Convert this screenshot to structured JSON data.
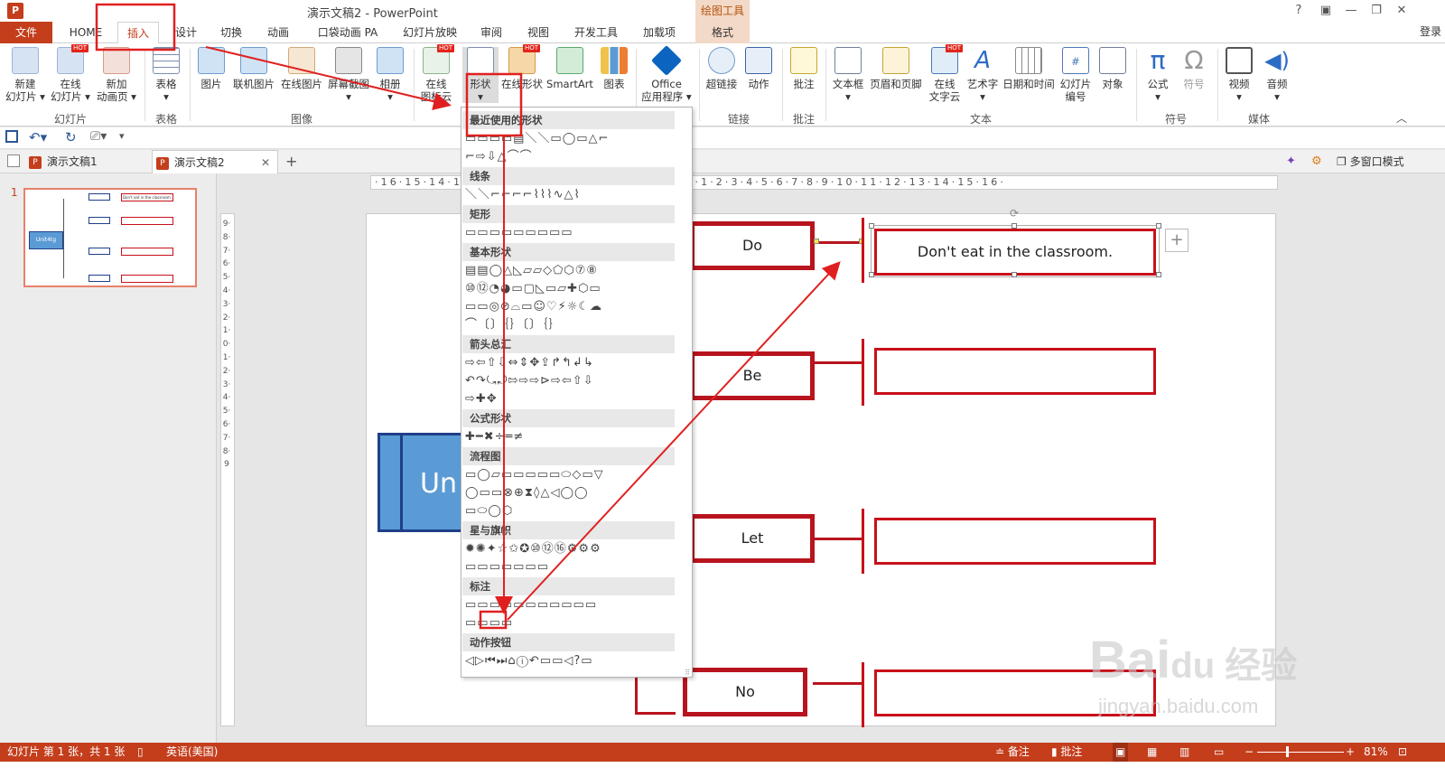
{
  "app": {
    "icon": "P",
    "title": "演示文稿2 - PowerPoint",
    "context_tab_title": "绘图工具",
    "login": "登录",
    "win_help": "?"
  },
  "tabs": [
    {
      "label": "文件"
    },
    {
      "label": "HOME"
    },
    {
      "label": "插入"
    },
    {
      "label": "设计"
    },
    {
      "label": "切换"
    },
    {
      "label": "动画"
    },
    {
      "label": "口袋动画 PA"
    },
    {
      "label": "幻灯片放映"
    },
    {
      "label": "审阅"
    },
    {
      "label": "视图"
    },
    {
      "label": "开发工具"
    },
    {
      "label": "加载项"
    },
    {
      "label": "格式"
    }
  ],
  "ribbon": {
    "buttons": [
      {
        "l1": "新建",
        "l2": "幻灯片 ▾"
      },
      {
        "l1": "在线",
        "l2": "幻灯片 ▾"
      },
      {
        "l1": "新加",
        "l2": "动画页 ▾"
      },
      {
        "l1": "表格",
        "l2": "▾"
      },
      {
        "l1": "图片",
        "l2": ""
      },
      {
        "l1": "联机图片",
        "l2": ""
      },
      {
        "l1": "在线图片",
        "l2": ""
      },
      {
        "l1": "屏幕截图",
        "l2": "▾"
      },
      {
        "l1": "相册",
        "l2": "▾"
      },
      {
        "l1": "在线",
        "l2": "图标云"
      },
      {
        "l1": "形状",
        "l2": "▾"
      },
      {
        "l1": "在线形状",
        "l2": ""
      },
      {
        "l1": "SmartArt",
        "l2": ""
      },
      {
        "l1": "图表",
        "l2": ""
      },
      {
        "l1": "Office",
        "l2": "应用程序 ▾"
      },
      {
        "l1": "超链接",
        "l2": ""
      },
      {
        "l1": "动作",
        "l2": ""
      },
      {
        "l1": "批注",
        "l2": ""
      },
      {
        "l1": "文本框",
        "l2": "▾"
      },
      {
        "l1": "页眉和页脚",
        "l2": ""
      },
      {
        "l1": "在线",
        "l2": "文字云"
      },
      {
        "l1": "艺术字",
        "l2": "▾"
      },
      {
        "l1": "日期和时间",
        "l2": ""
      },
      {
        "l1": "幻灯片",
        "l2": "编号"
      },
      {
        "l1": "对象",
        "l2": ""
      },
      {
        "l1": "公式",
        "l2": "▾"
      },
      {
        "l1": "符号",
        "l2": ""
      },
      {
        "l1": "视频",
        "l2": "▾"
      },
      {
        "l1": "音频",
        "l2": "▾"
      }
    ],
    "hot": "HOT",
    "groups": [
      "幻灯片",
      "表格",
      "图像",
      "链接",
      "批注",
      "文本",
      "符号",
      "媒体"
    ]
  },
  "doctabs": {
    "tab1": "演示文稿1",
    "tab2": "演示文稿2",
    "close": "✕",
    "add": "+",
    "multi_window": "多窗口模式"
  },
  "thumb": {
    "num": "1",
    "center": "Unit4tg",
    "answer": "Don't eat in the classroom."
  },
  "ruler": {
    "h_ticks": "·16·15·14·13·12·11·10·9·8·7·6·5·4·3·2·1·0·1·2·3·4·5·6·7·8·9·10·11·12·13·14·15·16·",
    "v_ticks": "9·8·7·6·5·4·3·2·1·0·1·2·3·4·5·6·7·8·9"
  },
  "slide": {
    "center_label": "Un",
    "keywords": [
      "Do",
      "Be",
      "Let",
      "No"
    ],
    "answer1": "Don't eat in the classroom."
  },
  "shapes_dropdown": {
    "categories": [
      "最近使用的形状",
      "线条",
      "矩形",
      "基本形状",
      "箭头总汇",
      "公式形状",
      "流程图",
      "星与旗帜",
      "标注",
      "动作按钮"
    ],
    "rows": [
      "▭▭▭▭▤＼＼▭◯▭△⌐",
      "⌐⇨⇩△⌒⌒",
      "＼＼⌐⌐⌐⌐⌇⌇⌇∿△⌇",
      "▭▭▭▭▭▭▭▭▭",
      "▤▤◯△◺▱▱◇⬠⬡⑦⑧",
      "⑩⑫◔◕▭▢◺▭▱✚⬡▭",
      "▭▭◎⊘⌓▭☺♡⚡☼☾☁",
      "⌒〔〕｛｝〔〕｛｝",
      "⇨⇦⇧⇩⇔⇕✥⇪↱↰↲↳",
      "↶↷⤿⤾⇰⇨⇨⊳⇨⇦⇧⇩",
      "⇨✚✥",
      "✚━✖÷═≠",
      "▭◯▱▭▭▭▭▭⬭◇▭▽",
      "◯▭▭⊗⊕⧗◊△◁◯◯",
      "▭⬭◯⬡",
      "✹✺✦☆✩✪⑩⑫⑯⚙⚙⚙",
      "▭▭▭▭▭▭▭",
      "▭▭▭▭▭▭▭▭▭▭▭",
      "▭▭▭▭",
      "◁▷⏮⏭⌂ⓘ↶▭▭◁?▭"
    ]
  },
  "status": {
    "slide_info": "幻灯片 第 1 张，共 1 张",
    "lang": "英语(美国)",
    "notes": "≐ 备注",
    "comments": "▮ 批注",
    "zoom": "81%"
  },
  "watermark": {
    "brand": "Bai",
    "brand2": "du 经验",
    "url": "jingyan.baidu.com"
  },
  "colors": {
    "accent": "#c43e1c",
    "slide_red": "#b8141e",
    "annotation_red": "#e02020",
    "center_blue": "#5b9bd5"
  }
}
